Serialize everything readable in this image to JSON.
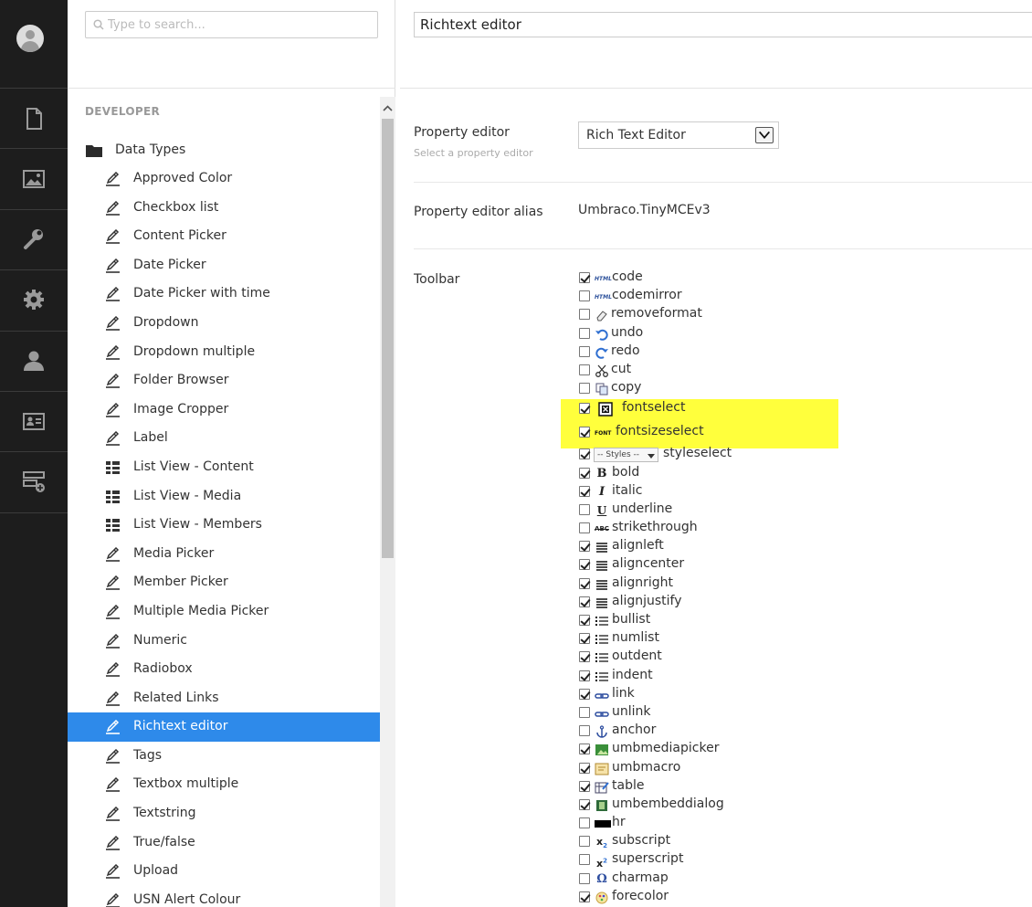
{
  "sidebar": {
    "icons": [
      "user-avatar-icon",
      "content-icon",
      "media-icon",
      "developer-wrench-icon",
      "settings-gear-icon",
      "users-icon",
      "members-icon",
      "forms-icon"
    ]
  },
  "tree": {
    "search_placeholder": "Type to search...",
    "section_label": "DEVELOPER",
    "folder_label": "Data Types",
    "items": [
      {
        "label": "Approved Color",
        "icon": "pencil-icon"
      },
      {
        "label": "Checkbox list",
        "icon": "pencil-icon"
      },
      {
        "label": "Content Picker",
        "icon": "pencil-icon"
      },
      {
        "label": "Date Picker",
        "icon": "pencil-icon"
      },
      {
        "label": "Date Picker with time",
        "icon": "pencil-icon"
      },
      {
        "label": "Dropdown",
        "icon": "pencil-icon"
      },
      {
        "label": "Dropdown multiple",
        "icon": "pencil-icon"
      },
      {
        "label": "Folder Browser",
        "icon": "pencil-icon"
      },
      {
        "label": "Image Cropper",
        "icon": "pencil-icon"
      },
      {
        "label": "Label",
        "icon": "pencil-icon"
      },
      {
        "label": "List View - Content",
        "icon": "list-view-icon"
      },
      {
        "label": "List View - Media",
        "icon": "list-view-icon"
      },
      {
        "label": "List View - Members",
        "icon": "list-view-icon"
      },
      {
        "label": "Media Picker",
        "icon": "pencil-icon"
      },
      {
        "label": "Member Picker",
        "icon": "pencil-icon"
      },
      {
        "label": "Multiple Media Picker",
        "icon": "pencil-icon"
      },
      {
        "label": "Numeric",
        "icon": "pencil-icon"
      },
      {
        "label": "Radiobox",
        "icon": "pencil-icon"
      },
      {
        "label": "Related Links",
        "icon": "pencil-icon"
      },
      {
        "label": "Richtext editor",
        "icon": "pencil-icon",
        "active": true
      },
      {
        "label": "Tags",
        "icon": "pencil-icon"
      },
      {
        "label": "Textbox multiple",
        "icon": "pencil-icon"
      },
      {
        "label": "Textstring",
        "icon": "pencil-icon"
      },
      {
        "label": "True/false",
        "icon": "pencil-icon"
      },
      {
        "label": "Upload",
        "icon": "pencil-icon"
      },
      {
        "label": "USN Alert Colour",
        "icon": "pencil-icon"
      }
    ]
  },
  "editor": {
    "name_value": "Richtext editor",
    "property_editor_label": "Property editor",
    "property_editor_desc": "Select a property editor",
    "property_editor_value": "Rich Text Editor",
    "alias_label": "Property editor alias",
    "alias_value": "Umbraco.TinyMCEv3",
    "toolbar_label": "Toolbar",
    "toolbar": [
      {
        "name": "code",
        "checked": true,
        "icon": "HTML"
      },
      {
        "name": "codemirror",
        "checked": false,
        "icon": "HTML"
      },
      {
        "name": "removeformat",
        "checked": false,
        "icon": "eraser"
      },
      {
        "name": "undo",
        "checked": false,
        "icon": "undo"
      },
      {
        "name": "redo",
        "checked": false,
        "icon": "redo"
      },
      {
        "name": "cut",
        "checked": false,
        "icon": "scissors"
      },
      {
        "name": "copy",
        "checked": false,
        "icon": "copy"
      },
      {
        "name": "fontselect",
        "checked": true,
        "icon": "font-box"
      },
      {
        "name": "fontsizeselect",
        "checked": true,
        "icon": "FONT"
      },
      {
        "name": "styleselect",
        "checked": true,
        "icon": "styles-dropdown",
        "dropdown_text": "-- Styles --"
      },
      {
        "name": "bold",
        "checked": true,
        "icon": "B"
      },
      {
        "name": "italic",
        "checked": true,
        "icon": "I"
      },
      {
        "name": "underline",
        "checked": false,
        "icon": "U"
      },
      {
        "name": "strikethrough",
        "checked": false,
        "icon": "ABC"
      },
      {
        "name": "alignleft",
        "checked": true,
        "icon": "align"
      },
      {
        "name": "aligncenter",
        "checked": true,
        "icon": "align"
      },
      {
        "name": "alignright",
        "checked": true,
        "icon": "align"
      },
      {
        "name": "alignjustify",
        "checked": true,
        "icon": "align"
      },
      {
        "name": "bullist",
        "checked": true,
        "icon": "list"
      },
      {
        "name": "numlist",
        "checked": true,
        "icon": "list"
      },
      {
        "name": "outdent",
        "checked": true,
        "icon": "list"
      },
      {
        "name": "indent",
        "checked": true,
        "icon": "list"
      },
      {
        "name": "link",
        "checked": true,
        "icon": "link"
      },
      {
        "name": "unlink",
        "checked": false,
        "icon": "link"
      },
      {
        "name": "anchor",
        "checked": false,
        "icon": "anchor"
      },
      {
        "name": "umbmediapicker",
        "checked": true,
        "icon": "media"
      },
      {
        "name": "umbmacro",
        "checked": true,
        "icon": "macro"
      },
      {
        "name": "table",
        "checked": true,
        "icon": "table"
      },
      {
        "name": "umbembeddialog",
        "checked": true,
        "icon": "film"
      },
      {
        "name": "hr",
        "checked": false,
        "icon": "hr"
      },
      {
        "name": "subscript",
        "checked": false,
        "icon": "sub"
      },
      {
        "name": "superscript",
        "checked": false,
        "icon": "sup"
      },
      {
        "name": "charmap",
        "checked": false,
        "icon": "omega"
      },
      {
        "name": "forecolor",
        "checked": true,
        "icon": "color"
      }
    ]
  }
}
